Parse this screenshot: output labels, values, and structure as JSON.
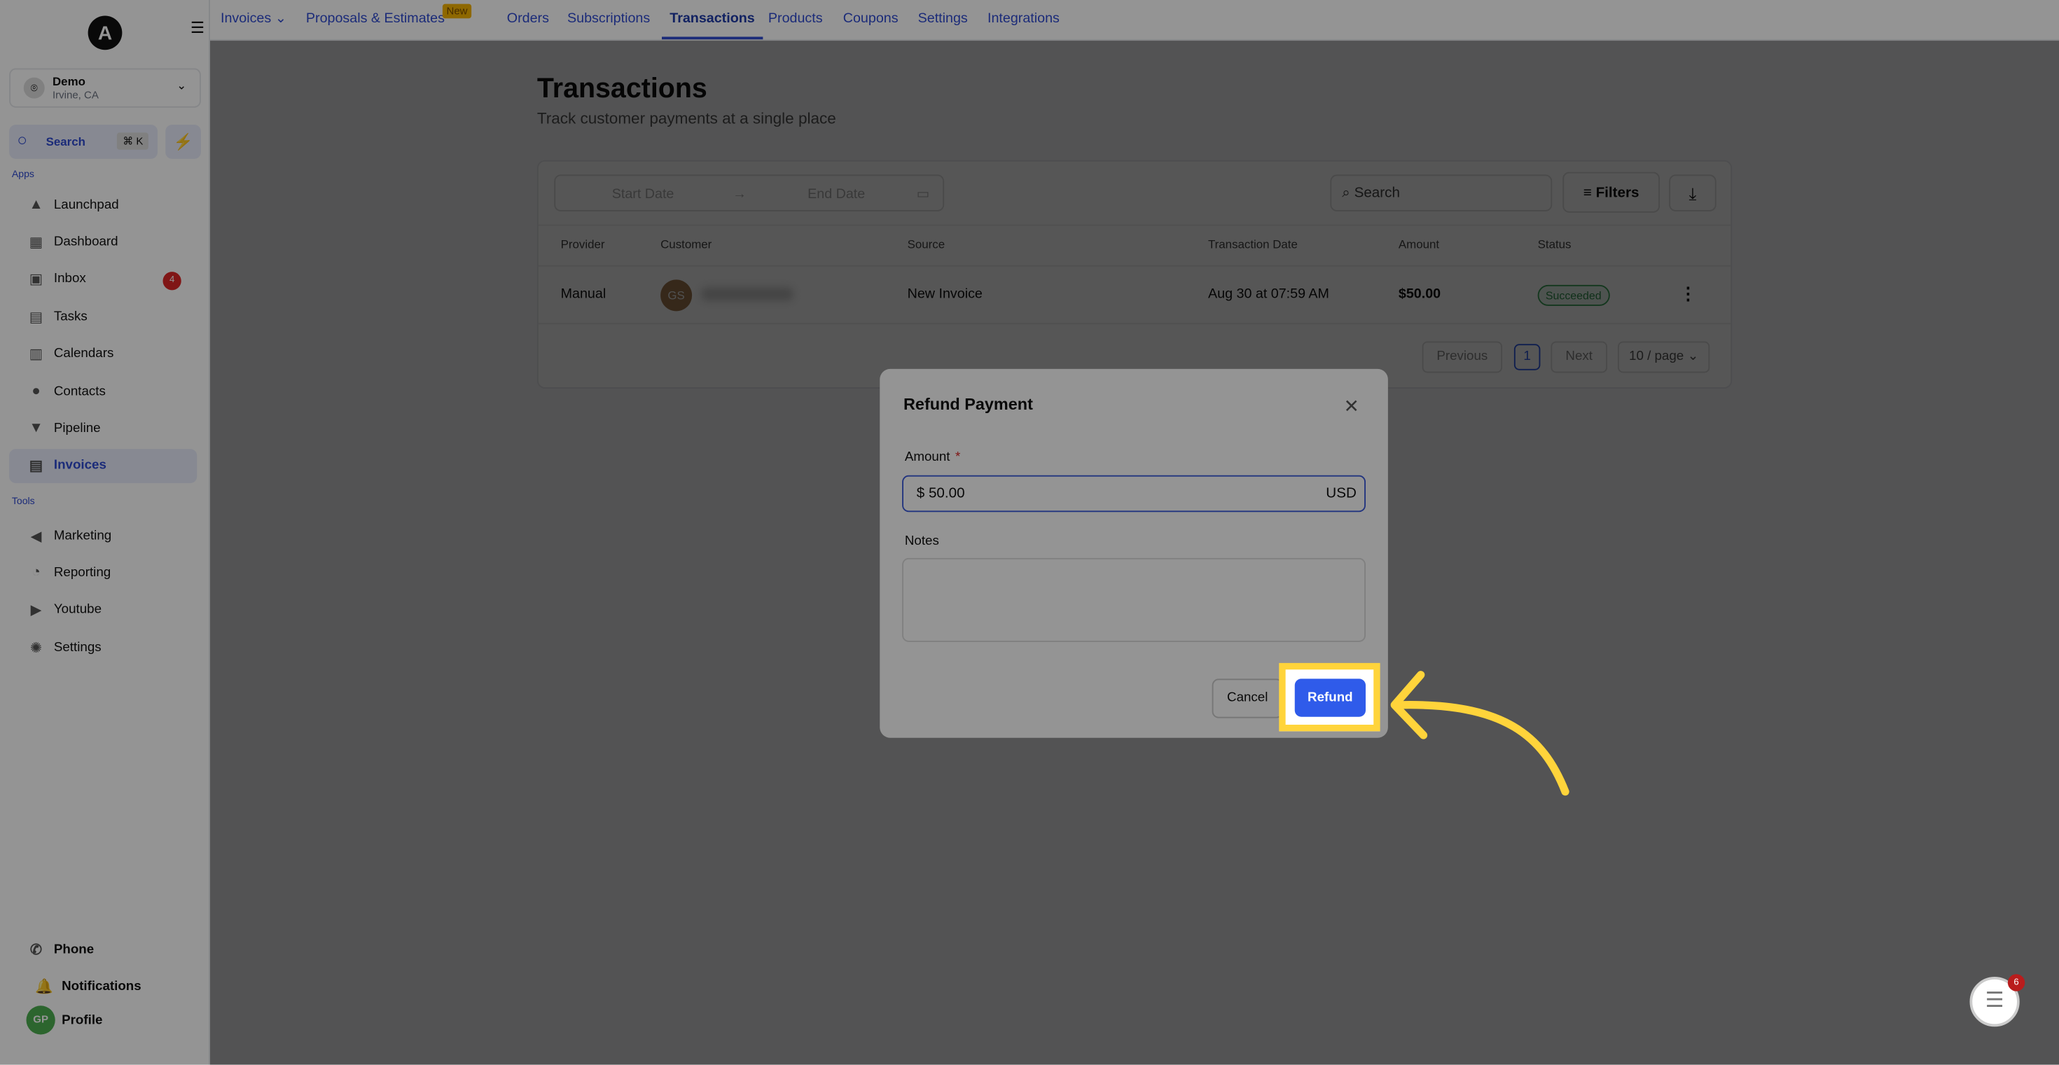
{
  "sidebar": {
    "logo": "A",
    "location": {
      "name": "Demo",
      "city": "Irvine, CA"
    },
    "search": {
      "label": "Search",
      "shortcut": "⌘ K"
    },
    "apps_label": "Apps",
    "tools_label": "Tools",
    "apps": [
      {
        "label": "Launchpad",
        "icon": "rocket-icon"
      },
      {
        "label": "Dashboard",
        "icon": "grid-icon"
      },
      {
        "label": "Inbox",
        "icon": "inbox-icon",
        "badge": "4"
      },
      {
        "label": "Tasks",
        "icon": "clipboard-icon"
      },
      {
        "label": "Calendars",
        "icon": "calendar-icon"
      },
      {
        "label": "Contacts",
        "icon": "person-icon"
      },
      {
        "label": "Pipeline",
        "icon": "funnel-icon"
      },
      {
        "label": "Invoices",
        "icon": "invoice-icon",
        "active": true
      }
    ],
    "tools": [
      {
        "label": "Marketing",
        "icon": "megaphone-icon"
      },
      {
        "label": "Reporting",
        "icon": "pie-icon"
      },
      {
        "label": "Youtube",
        "icon": "youtube-icon"
      },
      {
        "label": "Settings",
        "icon": "gear-icon"
      }
    ],
    "bottom": [
      {
        "label": "Phone",
        "icon": "phone-icon"
      },
      {
        "label": "Notifications",
        "icon": "bell-icon"
      },
      {
        "label": "Profile",
        "avatar": "GP"
      }
    ]
  },
  "topnav": {
    "tabs": [
      "Invoices",
      "Proposals & Estimates",
      "Orders",
      "Subscriptions",
      "Transactions",
      "Products",
      "Coupons",
      "Settings",
      "Integrations"
    ],
    "active": "Transactions",
    "new_badge": "New"
  },
  "page": {
    "title": "Transactions",
    "subtitle": "Track customer payments at a single place"
  },
  "toolbar": {
    "start_placeholder": "Start Date",
    "end_placeholder": "End Date",
    "search_placeholder": "Search",
    "filters_label": "Filters"
  },
  "table": {
    "headers": [
      "Provider",
      "Customer",
      "Source",
      "Transaction Date",
      "Amount",
      "Status"
    ],
    "rows": [
      {
        "provider": "Manual",
        "customer_initials": "GS",
        "source": "New Invoice",
        "date": "Aug 30 at 07:59 AM",
        "amount": "$50.00",
        "status": "Succeeded"
      }
    ]
  },
  "pagination": {
    "previous": "Previous",
    "current": "1",
    "next": "Next",
    "per_page": "10 / page"
  },
  "modal": {
    "title": "Refund Payment",
    "amount_label": "Amount",
    "required_mark": "*",
    "amount_value": "$ 50.00",
    "currency": "USD",
    "notes_label": "Notes",
    "notes_value": "",
    "cancel_label": "Cancel",
    "refund_label": "Refund"
  },
  "chat_badge": "6",
  "colors": {
    "accent": "#2f5bea",
    "highlight": "#ffd43b",
    "success": "#2f8f4a"
  }
}
